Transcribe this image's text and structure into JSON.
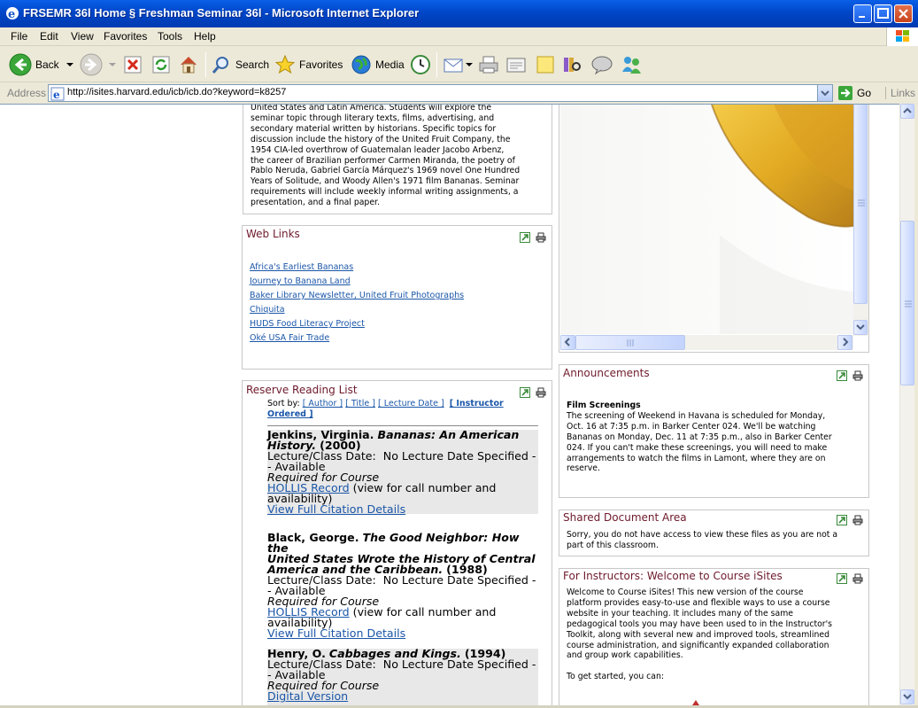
{
  "window": {
    "title": "FRSEMR 36l Home § Freshman Seminar 36l - Microsoft Internet Explorer"
  },
  "menu": [
    "File",
    "Edit",
    "View",
    "Favorites",
    "Tools",
    "Help"
  ],
  "toolbar": {
    "back": "Back",
    "search": "Search",
    "favorites": "Favorites",
    "media": "Media"
  },
  "address": {
    "label": "Address",
    "url": "http://isites.harvard.edu/icb/icb.do?keyword=k8257",
    "go": "Go",
    "links": "Links"
  },
  "description": {
    "lines": [
      "United States and Latin America. Students will explore the",
      "seminar topic through literary texts, films, advertising, and",
      "secondary material written by historians. Specific topics for",
      "discussion include the history of the United Fruit Company, the",
      "1954 CIA-led overthrow of Guatemalan leader Jacobo Arbenz,",
      "the career of Brazilian performer Carmen Miranda, the poetry of",
      "Pablo Neruda, Gabriel García Márquez's 1969 novel One Hundred",
      "Years of Solitude, and Woody Allen's 1971 film Bananas. Seminar",
      "requirements will include weekly informal writing assignments, a",
      "presentation, and a final paper."
    ]
  },
  "web_links": {
    "title": "Web Links",
    "items": [
      "Africa's Earliest Bananas",
      "Journey to Banana Land",
      "Baker Library Newsletter, United Fruit Photographs",
      "Chiquita",
      "HUDS Food Literacy Project",
      "Oké USA Fair Trade"
    ]
  },
  "reading_list": {
    "title": "Reserve Reading List",
    "sort_by": "Sort by:",
    "sort_options": [
      "[ Author ]",
      "[ Title ]",
      "[ Lecture Date ]",
      "[ Instructor",
      "Ordered ]"
    ],
    "lecture_label": "Lecture/Class Date:",
    "items": [
      {
        "author": "Jenkins, Virginia.",
        "title_l1": "Bananas: An American",
        "title_l2": "History.",
        "year": "(2000)",
        "lecture_l1": "No Lecture Date Specified -",
        "lecture_l2": "- Available",
        "required": "Required for Course",
        "record": "HOLLIS Record",
        "record_note_l1": "(view for call number and",
        "record_note_l2": "availability)",
        "details": "View Full Citation Details"
      },
      {
        "author": "Black, George.",
        "title_l1": "The Good Neighbor: How the",
        "title_l2": "United States Wrote the History of Central",
        "title_l3": "America and the Caribbean.",
        "year": "(1988)",
        "lecture_l1": "No Lecture Date Specified -",
        "lecture_l2": "- Available",
        "required": "Required for Course",
        "record": "HOLLIS Record",
        "record_note_l1": "(view for call number and",
        "record_note_l2": "availability)",
        "details": "View Full Citation Details"
      },
      {
        "author": "Henry, O.",
        "title_l1": "Cabbages and Kings.",
        "year": "(1994)",
        "lecture_l1": "No Lecture Date Specified -",
        "lecture_l2": "- Available",
        "required": "Required for Course",
        "record": "Digital Version"
      }
    ]
  },
  "announcements": {
    "title": "Announcements",
    "heading": "Film Screenings",
    "lines": [
      "The screening of Weekend in Havana is scheduled for Monday,",
      "Oct. 16 at 7:35 p.m. in Barker Center 024. We'll be watching",
      "Bananas on Monday, Dec. 11 at 7:35 p.m., also in Barker Center",
      "024. If you can't make these screenings, you will need to make",
      "arrangements to watch the films in Lamont, where they are on",
      "reserve."
    ]
  },
  "shared_docs": {
    "title": "Shared Document Area",
    "lines": [
      "Sorry, you do not have access to view these files as you are not a",
      "part of this classroom."
    ]
  },
  "instructors": {
    "title": "For Instructors: Welcome to Course iSites",
    "lines": [
      "Welcome to Course iSites! This new version of the course",
      "platform provides easy-to-use and flexible ways to use a course",
      "website in your teaching. It includes many of the same",
      "pedagogical tools you may have been used to in the Instructor's",
      "Toolkit, along with several new and improved tools, streamlined",
      "course administration, and significantly expanded collaboration",
      "and group work capabilities."
    ],
    "get_started": "To get started, you can:"
  },
  "colors": {
    "panel_title": "#6e1a2b",
    "link": "#1a56a8",
    "titlebar": "#0a5fe8",
    "banana": "#e8b42c"
  }
}
